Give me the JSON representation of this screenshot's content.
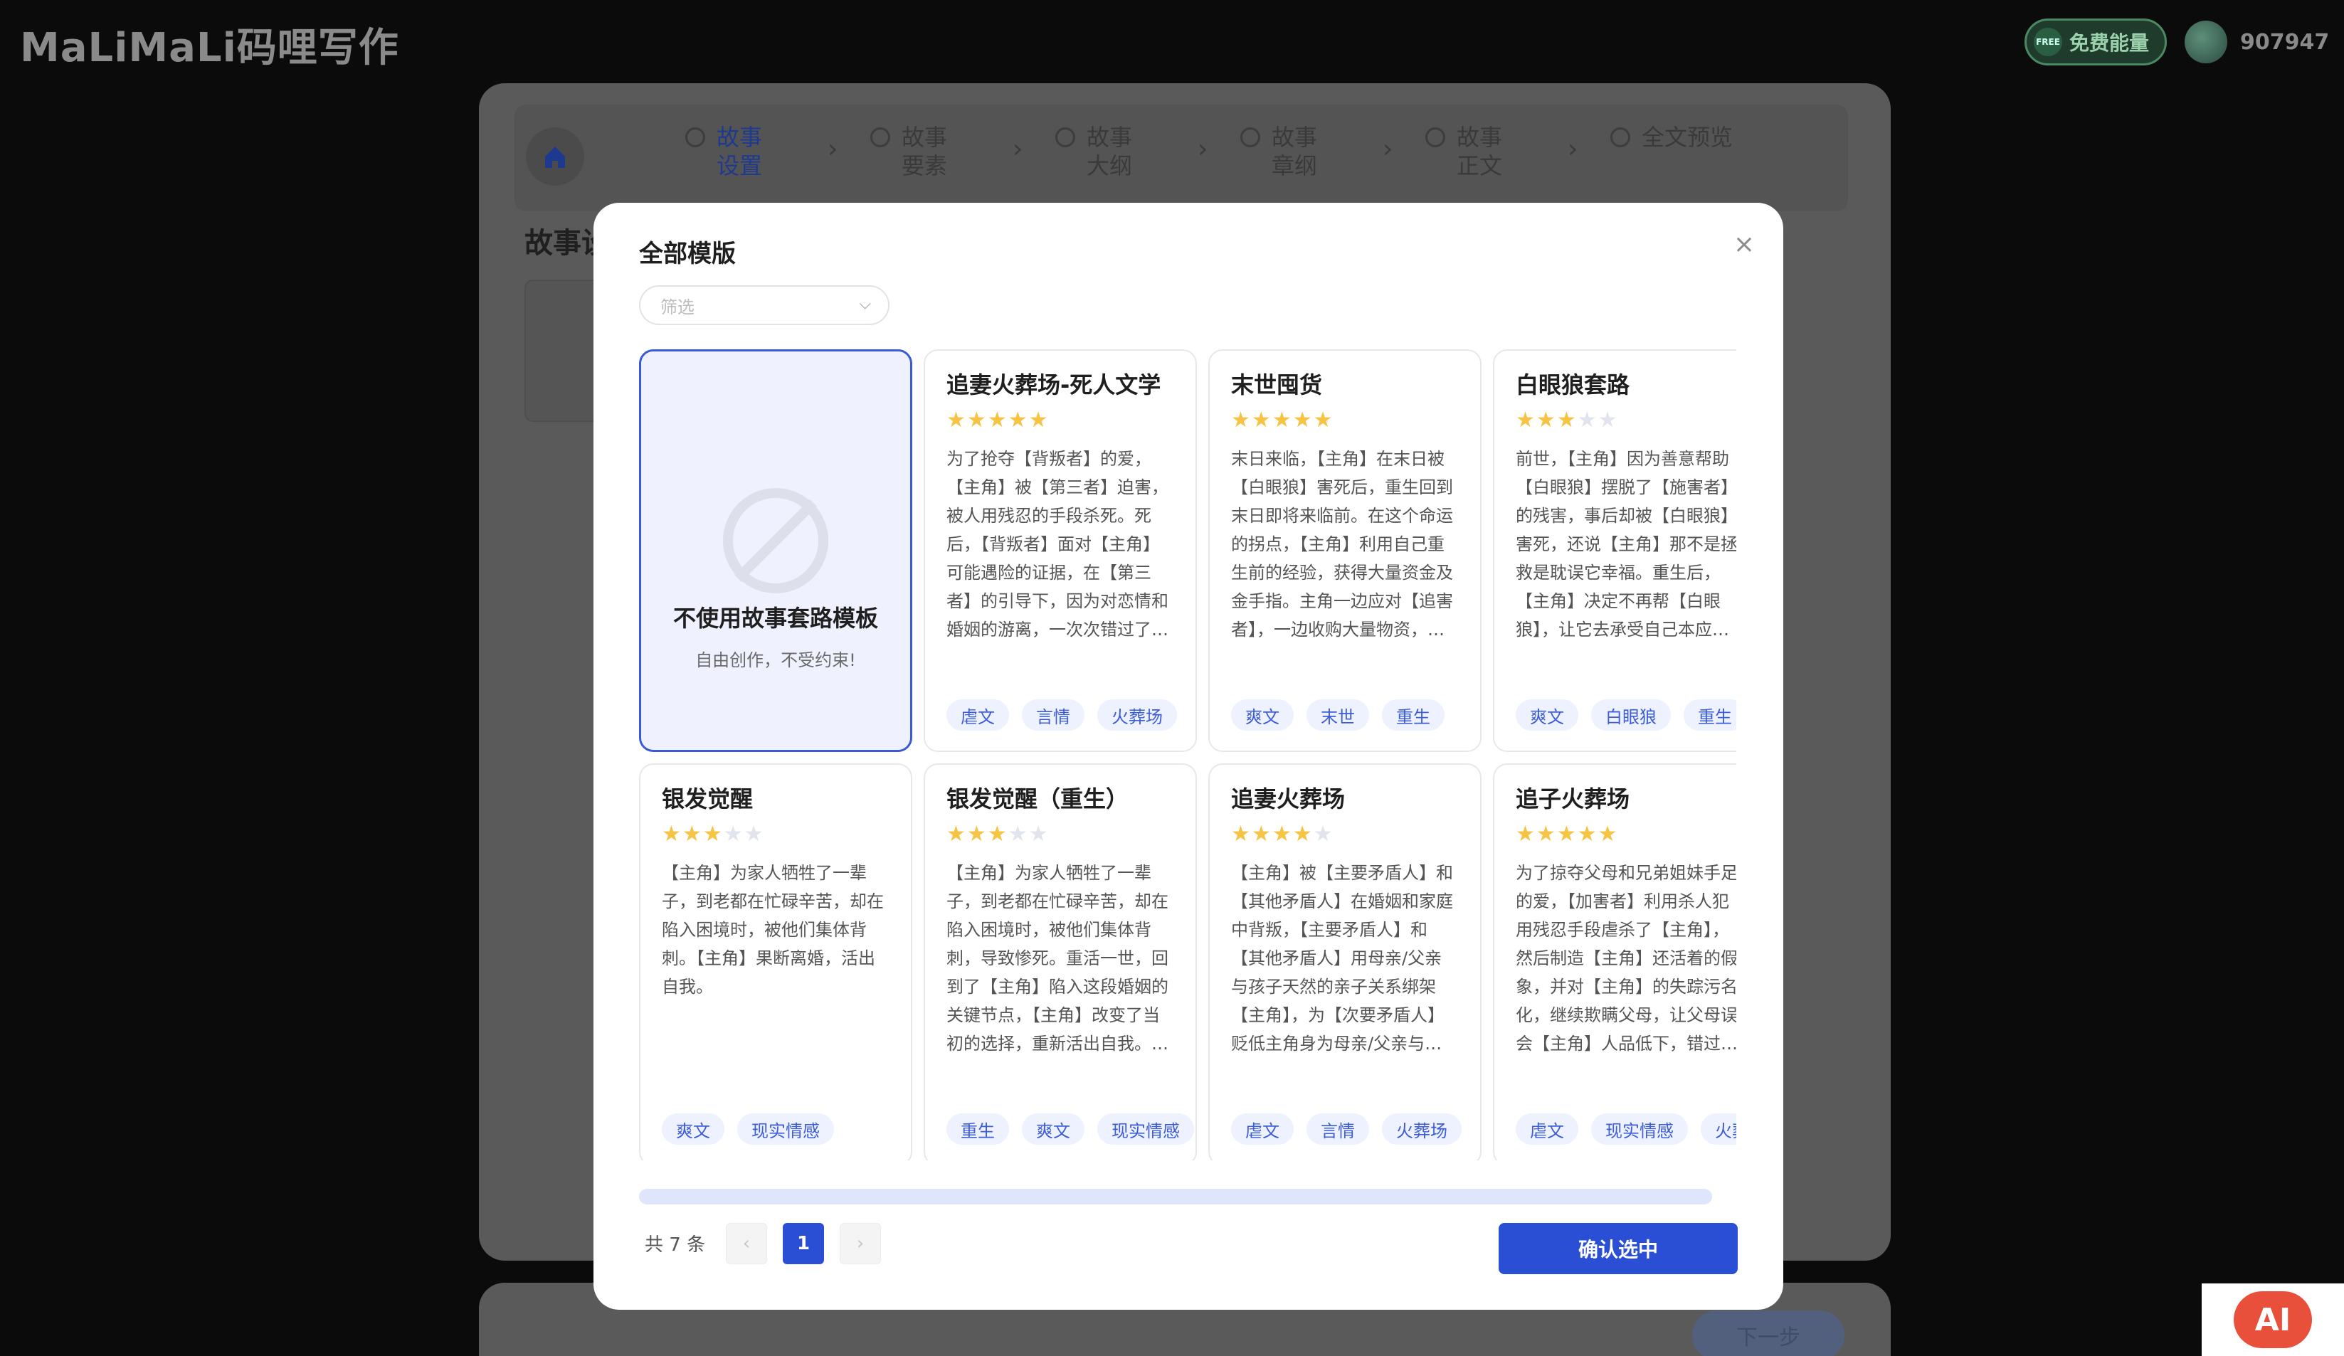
{
  "app": {
    "logo_text": "MaLiMaLi码哩写作",
    "free_energy_label": "免费能量",
    "free_badge": "FREE",
    "balance": "907947"
  },
  "background": {
    "steps": [
      {
        "label": "故事设置",
        "active": true
      },
      {
        "label": "故事要素",
        "active": false
      },
      {
        "label": "故事大纲",
        "active": false
      },
      {
        "label": "故事章纲",
        "active": false
      },
      {
        "label": "故事正文",
        "active": false
      },
      {
        "label": "全文预览",
        "active": false
      }
    ],
    "section_title": "故事设",
    "next_label": "下一步"
  },
  "modal": {
    "title": "全部模版",
    "filter_placeholder": "筛选",
    "none_option": {
      "title": "不使用故事套路模板",
      "subtitle": "自由创作，不受约束!"
    },
    "templates": [
      {
        "title": "追妻火葬场-死人文学",
        "rating": 4.5,
        "desc": "为了抢夺【背叛者】的爱，【主角】被【第三者】迫害，被人用残忍的手段杀死。死后，【背叛者】面对【主角】可能遇险的证据，在【第三者】的引导下，因为对恋情和婚姻的游离，一次次错过了解救【主角】或解开【主角】…",
        "tags": [
          "虐文",
          "言情",
          "火葬场"
        ]
      },
      {
        "title": "末世囤货",
        "rating": 5,
        "desc": "末日来临，【主角】在末日被【白眼狼】害死后，重生回到末日即将来临前。在这个命运的拐点，【主角】利用自己重生前的经验，获得大量资金及金手指。主角一边应对【追害者】，一边收购大量物资，建造自己的末日基地。末日降…",
        "tags": [
          "爽文",
          "末世",
          "重生"
        ]
      },
      {
        "title": "白眼狼套路",
        "rating": 3,
        "desc": "前世，【主角】因为善意帮助【白眼狼】摆脱了【施害者】的残害，事后却被【白眼狼】害死，还说【主角】那不是拯救是耽误它幸福。重生后，【主角】决定不再帮【白眼狼】，让它去承受自己本应承受的恶果。",
        "tags": [
          "爽文",
          "白眼狼",
          "重生"
        ]
      },
      {
        "title": "银发觉醒",
        "rating": 2.5,
        "desc": "【主角】为家人牺牲了一辈子，到老都在忙碌辛苦，却在陷入困境时，被他们集体背刺。【主角】果断离婚，活出自我。",
        "tags": [
          "爽文",
          "现实情感"
        ]
      },
      {
        "title": "银发觉醒（重生）",
        "rating": 3,
        "desc": "【主角】为家人牺牲了一辈子，到老都在忙碌辛苦，却在陷入困境时，被他们集体背刺，导致惨死。重活一世，回到了【主角】陷入这段婚姻的关键节点，【主角】改变了当初的选择，重新活出自我。而前世的家人，没了【主角】…",
        "tags": [
          "重生",
          "爽文",
          "现实情感"
        ]
      },
      {
        "title": "追妻火葬场",
        "rating": 4,
        "desc": "【主角】被【主要矛盾人】和【其他矛盾人】在婚姻和家庭中背叛，【主要矛盾人】和【其他矛盾人】用母亲/父亲与孩子天然的亲子关系绑架【主角】，为【次要矛盾人】贬低主角身为母亲/父亲与妻子/丈夫的付出以及身份，…",
        "tags": [
          "虐文",
          "言情",
          "火葬场"
        ]
      },
      {
        "title": "追子火葬场",
        "rating": 4.5,
        "desc": "为了掠夺父母和兄弟姐妹手足的爱，【加害者】利用杀人犯用残忍手段虐杀了【主角】，然后制造【主角】还活着的假象，并对【主角】的失踪污名化，继续欺瞒父母，让父母误会【主角】人品低下，错过了一次又一次揭开【主角】已…",
        "tags": [
          "虐文",
          "现实情感",
          "火葬场"
        ]
      }
    ],
    "pagination": {
      "total_label": "共 7 条",
      "current_page": "1",
      "prev_icon": "‹",
      "next_icon": "›"
    },
    "confirm_label": "确认选中",
    "close_icon": "×"
  },
  "watermark": {
    "text": "AI"
  }
}
